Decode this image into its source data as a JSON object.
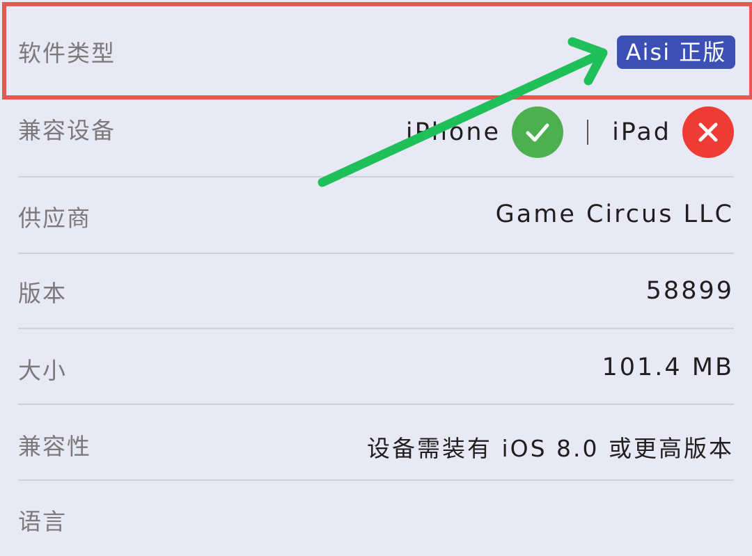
{
  "top_partial_text": "语言",
  "rows": {
    "software_type": {
      "label": "软件类型",
      "badge": "Aisi 正版"
    },
    "compatible_devices": {
      "label": "兼容设备",
      "iphone": "iPhone",
      "ipad": "iPad"
    },
    "vendor": {
      "label": "供应商",
      "value": "Game Circus LLC"
    },
    "version": {
      "label": "版本",
      "value": "58899"
    },
    "size": {
      "label": "大小",
      "value": "101.4 MB"
    },
    "compatibility": {
      "label": "兼容性",
      "value": "设备需装有 iOS 8.0 或更高版本"
    },
    "language": {
      "label": "语言"
    }
  },
  "colors": {
    "background": "#e8e9f4",
    "highlight_border": "#ea5550",
    "badge_bg": "#3b4fb5",
    "check_green": "#4caf50",
    "cross_red": "#ee3b35",
    "arrow_green": "#1fbf5a"
  },
  "icons": {
    "iphone_status": "check-icon",
    "ipad_status": "cross-icon",
    "annotation": "arrow-icon"
  }
}
